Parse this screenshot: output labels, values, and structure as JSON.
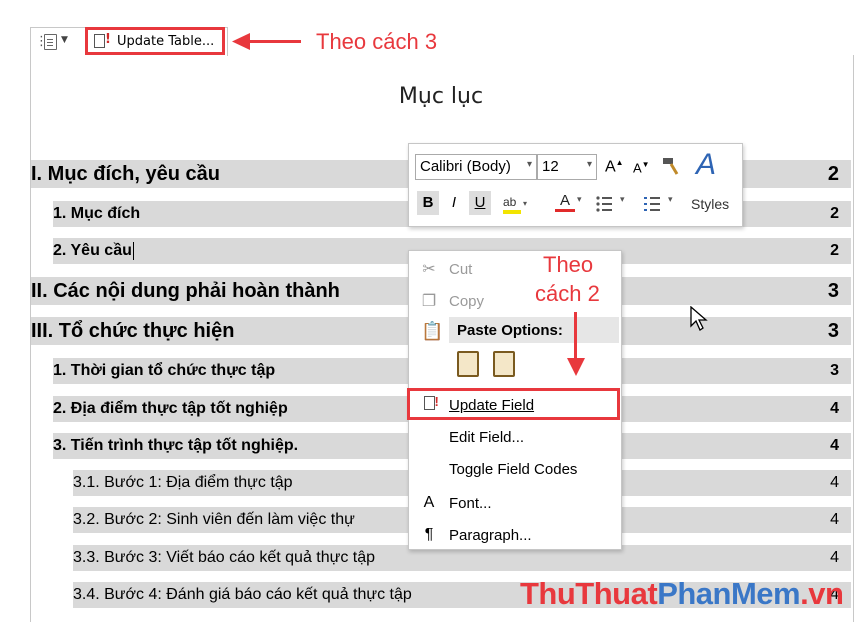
{
  "toolbar": {
    "update_table_label": "Update Table..."
  },
  "annotations": {
    "method3": "Theo cách 3",
    "method2_line1": "Theo",
    "method2_line2": "cách 2"
  },
  "document": {
    "title": "Mục lục",
    "toc": [
      {
        "text": "I. Mục đích, yêu cầu",
        "page": "2"
      },
      {
        "text": "1. Mục đích",
        "page": "2"
      },
      {
        "text": "2. Yêu cầu",
        "page": "2"
      },
      {
        "text": "II. Các nội dung phải hoàn thành",
        "page": "3"
      },
      {
        "text": "III. Tổ chức thực hiện",
        "page": "3"
      },
      {
        "text": "1. Thời gian tổ chức thực tập",
        "page": "3"
      },
      {
        "text": "2. Địa điểm thực tập tốt nghiệp",
        "page": "4"
      },
      {
        "text": "3. Tiến trình thực tập tốt nghiệp.",
        "page": "4"
      },
      {
        "text": "3.1. Bước 1: Địa điểm thực tập",
        "page": "4"
      },
      {
        "text": "3.2. Bước 2: Sinh viên đến làm việc thự",
        "page": "4"
      },
      {
        "text": "3.3. Bước 3: Viết báo cáo kết quả thực tập",
        "page": "4"
      },
      {
        "text": "3.4. Bước 4: Đánh giá báo cáo kết quả thực tập",
        "page": "4"
      }
    ]
  },
  "mini_toolbar": {
    "font": "Calibri (Body)",
    "size": "12",
    "bold": "B",
    "italic": "I",
    "underline": "U",
    "grow_font": "A",
    "shrink_font": "A",
    "font_color": "A",
    "styles_glyph": "A",
    "styles_label": "Styles"
  },
  "context_menu": {
    "cut": "Cut",
    "copy": "Copy",
    "paste_options": "Paste Options:",
    "update_field": "Update Field",
    "edit_field": "Edit Field...",
    "toggle_codes": "Toggle Field Codes",
    "font": "Font...",
    "font_icon": "A",
    "paragraph": "Paragraph..."
  },
  "watermark": {
    "part1": "ThuThuat",
    "part2": "PhanMem",
    "part3": ".vn"
  },
  "colors": {
    "annotation_red": "#e8383d",
    "toc_gray": "#d9d9d9",
    "watermark_blue": "#3a77c7"
  }
}
